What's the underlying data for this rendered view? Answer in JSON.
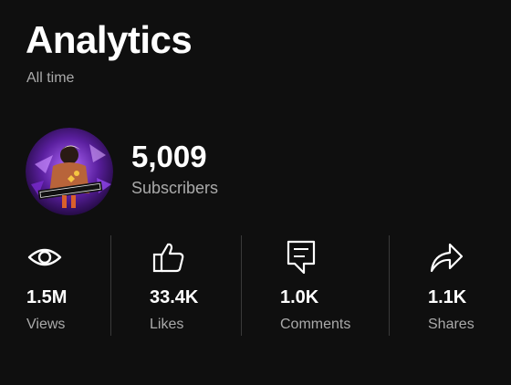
{
  "header": {
    "title": "Analytics",
    "period": "All time"
  },
  "channel": {
    "avatar_icon": "channel-avatar",
    "subscribers_value": "5,009",
    "subscribers_label": "Subscribers"
  },
  "stats": [
    {
      "icon": "eye-icon",
      "value": "1.5M",
      "label": "Views"
    },
    {
      "icon": "thumbs-up-icon",
      "value": "33.4K",
      "label": "Likes"
    },
    {
      "icon": "comment-icon",
      "value": "1.0K",
      "label": "Comments"
    },
    {
      "icon": "share-icon",
      "value": "1.1K",
      "label": "Shares"
    }
  ],
  "colors": {
    "background": "#0f0f0f",
    "primary_text": "#ffffff",
    "secondary_text": "#aaaaaa",
    "divider": "#3a3a3a"
  }
}
